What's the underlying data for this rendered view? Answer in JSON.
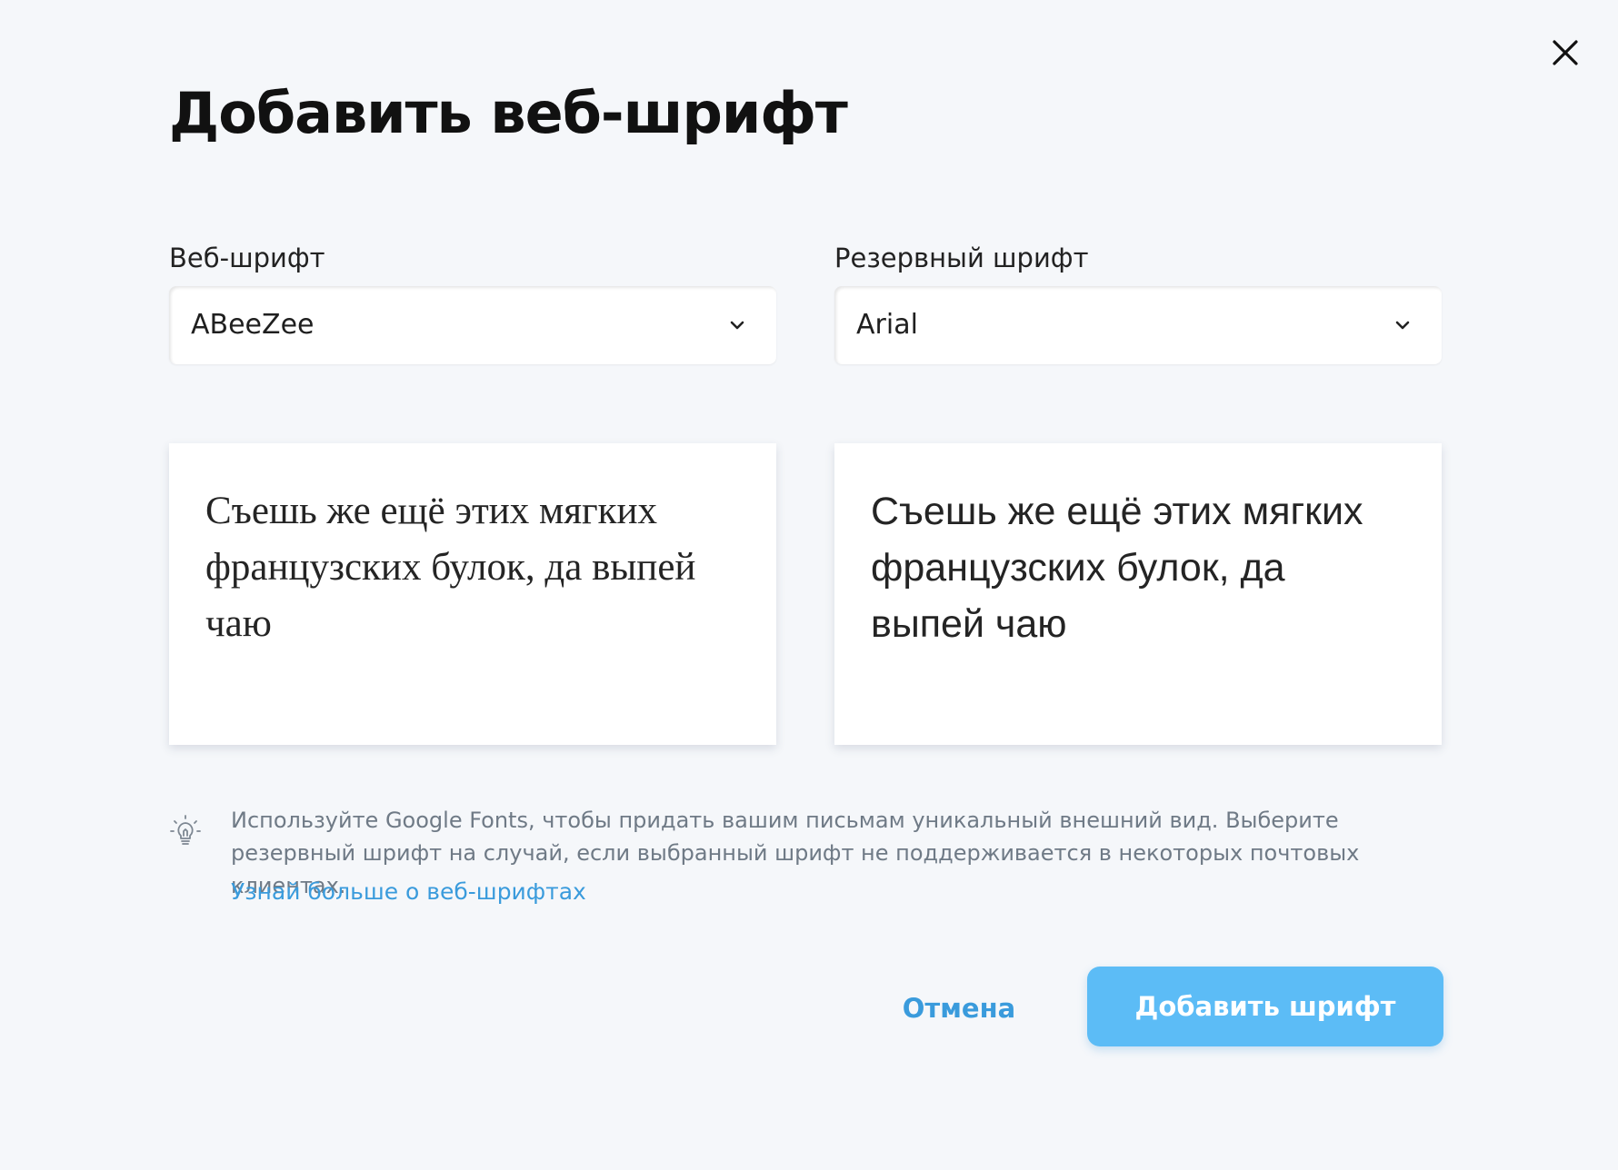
{
  "dialog": {
    "title": "Добавить веб-шрифт"
  },
  "web_font": {
    "label": "Веб-шрифт",
    "selected": "ABeeZee",
    "preview": "Съешь же ещё этих мягких французских булок, да выпей чаю"
  },
  "fallback_font": {
    "label": "Резервный шрифт",
    "selected": "Arial",
    "preview": "Съешь же ещё этих мягких французских булок, да выпей чаю"
  },
  "tip": {
    "text": "Используйте Google Fonts, чтобы придать вашим письмам уникальный внешний вид. Выберите резервный шрифт на случай, если выбранный шрифт не поддерживается в некоторых почтовых клиентах.",
    "link": "Узнай больше о веб-шрифтах"
  },
  "actions": {
    "cancel_label": "Отмена",
    "add_label": "Добавить шрифт"
  },
  "icons": {
    "close": "close-icon",
    "chevron": "chevron-down-icon",
    "tip": "lightbulb-icon"
  },
  "colors": {
    "background": "#f5f7fa",
    "accent": "#3a9bdc",
    "primary_button": "#5cbcf6",
    "tip_text": "#6f7a86"
  }
}
